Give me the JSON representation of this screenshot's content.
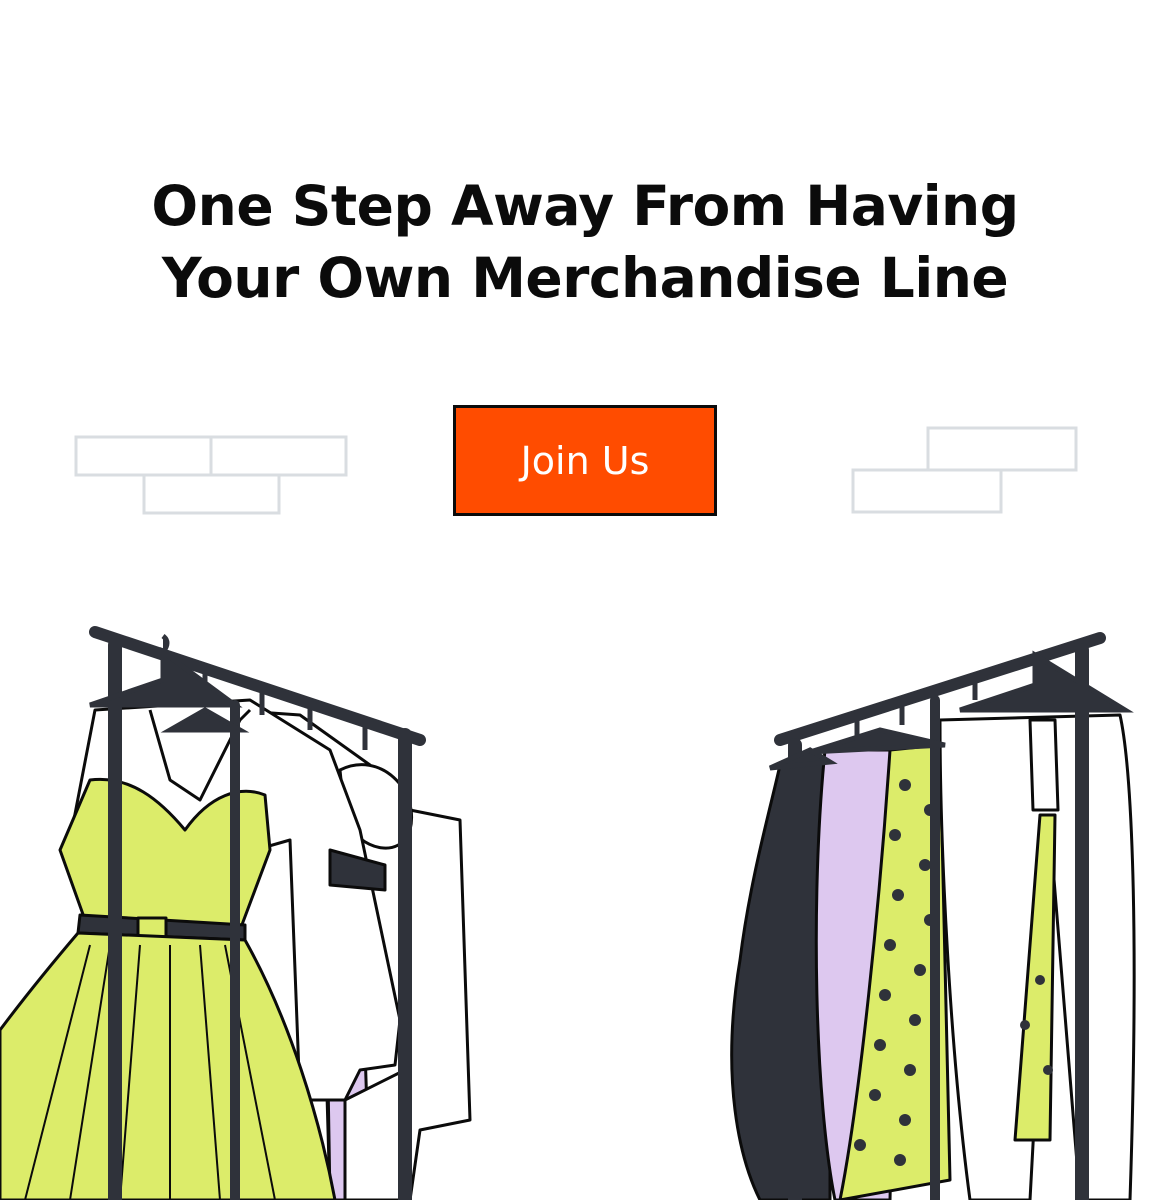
{
  "hero": {
    "headline_line1": "One Step Away From Having",
    "headline_line2": "Your Own Merchandise Line"
  },
  "cta": {
    "label": "Join Us",
    "color": "#ff4c00"
  },
  "colors": {
    "text": "#0b0b0b",
    "lime": "#dcec6a",
    "lavender": "#ddc8ef",
    "dark": "#2f323a",
    "brick": "#d9dde1"
  },
  "icons": [
    "wall-bricks-icon",
    "clothing-rack-illustration"
  ]
}
